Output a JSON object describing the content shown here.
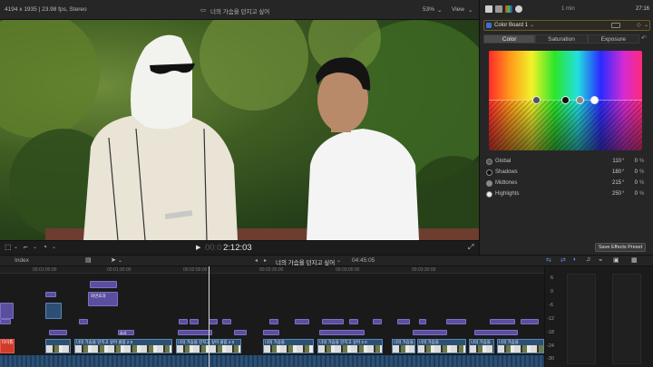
{
  "viewer": {
    "format_info": "4194 x 1935 | 23.98 fps, Stereo",
    "clip_title": "너의 가슴을 던지고 싶어",
    "zoom": "53%",
    "view_label": "View",
    "timecode_dim": "00:0",
    "timecode": "2:12:03"
  },
  "inspector": {
    "duration": "1 min",
    "timecode": "27:16",
    "board_label": "Color Board 1",
    "tabs": [
      "Color",
      "Saturation",
      "Exposure"
    ],
    "active_tab": "Color",
    "controls": [
      {
        "name": "Global",
        "degrees": "110",
        "percent": "0"
      },
      {
        "name": "Shadows",
        "degrees": "180",
        "percent": "0"
      },
      {
        "name": "Midtones",
        "degrees": "215",
        "percent": "0"
      },
      {
        "name": "Highlights",
        "degrees": "250",
        "percent": "0"
      }
    ],
    "degree_sign": "°",
    "percent_sign": "%",
    "save_preset_label": "Save Effects Preset"
  },
  "timeline": {
    "index_label": "Index",
    "project_title": "너의 가슴을 던지고 싶어",
    "project_duration": "04:45:05",
    "ruler": [
      "00:01:00:00",
      "00:01:30:00",
      "00:02:00:00",
      "00:02:30:00",
      "00:03:00:00",
      "00:03:30:00"
    ],
    "clip_labels": [
      "너의 가슴을 던지고 싶어 클립 2 0",
      "너의 가슴을 던지고 싶어 클립 2 0",
      "너의 가슴을",
      "너의 가슴을 던지고 싶어 2 0",
      "너의 가슴을",
      "너의 가슴을",
      "너의 가슴을",
      "너의 가슴을"
    ],
    "title_clip_a": "화면효과",
    "title_clip_b": "효과",
    "red_clip_label": "타이틀"
  },
  "meters": {
    "scale": [
      "6",
      "0",
      "-6",
      "-12",
      "-18",
      "-24",
      "-30"
    ]
  }
}
